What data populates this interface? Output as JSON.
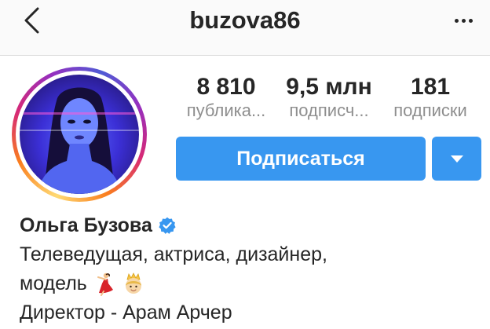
{
  "header": {
    "username": "buzova86",
    "back_icon": "chevron-left-icon",
    "more_icon": "more-horizontal-icon"
  },
  "profile": {
    "avatar_alt": "avatar"
  },
  "stats": {
    "posts": {
      "value": "8 810",
      "label": "публика..."
    },
    "followers": {
      "value": "9,5 млн",
      "label": "подписч..."
    },
    "following": {
      "value": "181",
      "label": "подписки"
    }
  },
  "actions": {
    "follow_label": "Подписаться",
    "dropdown_icon": "caret-down-icon"
  },
  "bio": {
    "full_name": "Ольга Бузова",
    "verified_icon": "verified-badge-icon",
    "line1": "Телеведущая, актриса, дизайнер,",
    "line2": "модель",
    "line3": "Директор - Арам Арчер"
  },
  "colors": {
    "accent": "#3897f0",
    "text": "#262626",
    "muted": "#8e8e8e",
    "topbar_bg": "#fafafa",
    "border": "#dbdbdb"
  }
}
